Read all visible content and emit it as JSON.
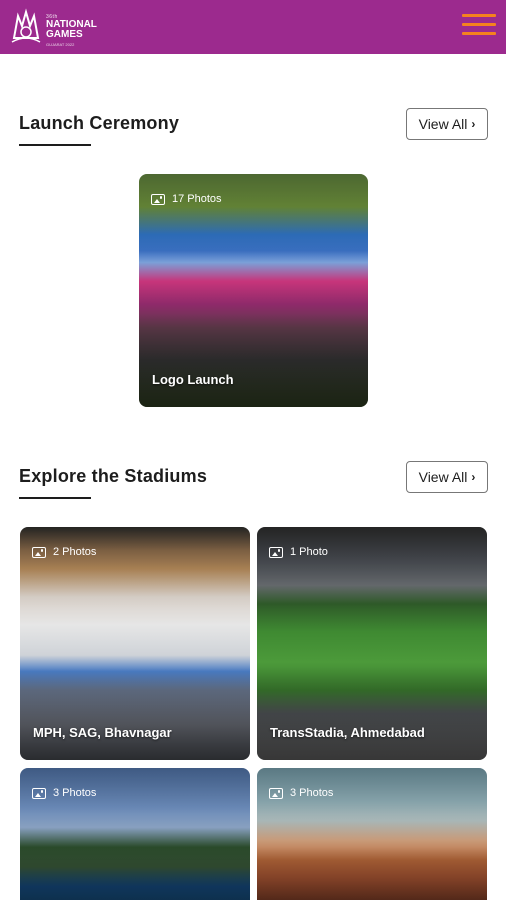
{
  "header": {
    "logo_small": "36th",
    "logo_big_1": "NATIONAL",
    "logo_big_2": "GAMES",
    "logo_tag": "GUJARAT 2022"
  },
  "sections": {
    "launch": {
      "title": "Launch Ceremony",
      "view_all": "View All"
    },
    "stadiums": {
      "title": "Explore the Stadiums",
      "view_all": "View All"
    }
  },
  "launch_cards": [
    {
      "count": "17 Photos",
      "title": "Logo Launch"
    }
  ],
  "stadium_cards": [
    {
      "count": "2 Photos",
      "title": "MPH, SAG, Bhavnagar"
    },
    {
      "count": "1 Photo",
      "title": "TransStadia, Ahmedabad"
    },
    {
      "count": "3 Photos",
      "title": ""
    },
    {
      "count": "3 Photos",
      "title": ""
    }
  ],
  "icons": {
    "menu": "hamburger-menu-icon",
    "photo": "image-icon",
    "chevron": "chevron-right-icon"
  },
  "colors": {
    "header_bg": "#9c2a8e",
    "menu_accent": "#f5821f"
  }
}
